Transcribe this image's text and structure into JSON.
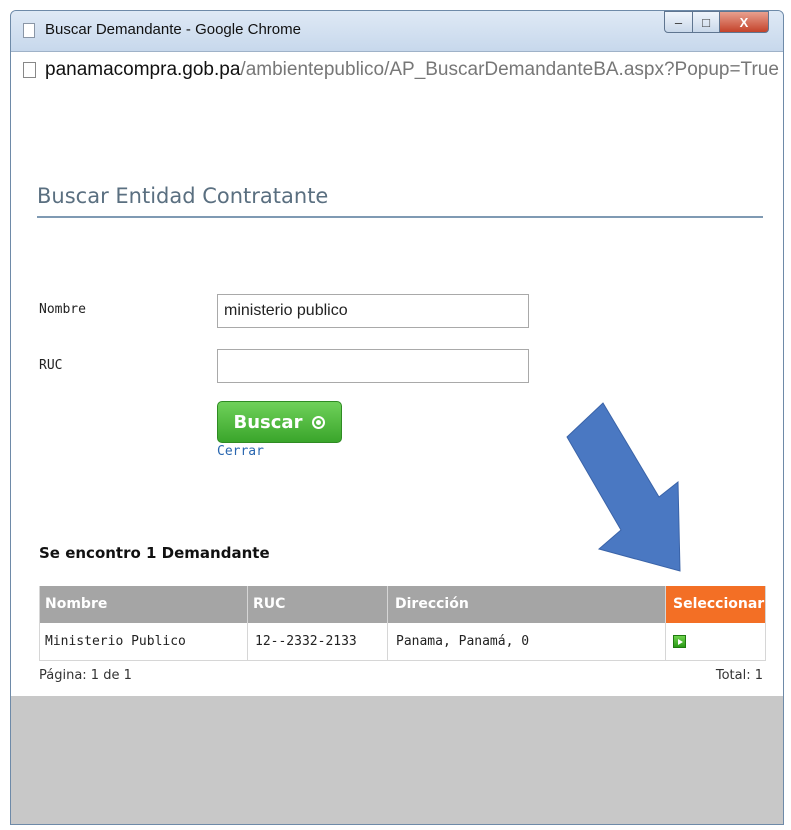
{
  "window": {
    "title": "Buscar Demandante - Google Chrome",
    "controls": {
      "minimize": "–",
      "maximize": "□",
      "close": "X"
    }
  },
  "address_bar": {
    "host": "panamacompra.gob.pa",
    "path": "/ambientepublico/AP_BuscarDemandanteBA.aspx?Popup=True"
  },
  "page": {
    "heading": "Buscar Entidad Contratante",
    "form": {
      "nombre_label": "Nombre",
      "nombre_value": "ministerio publico",
      "ruc_label": "RUC",
      "ruc_value": "",
      "search_button": "Buscar",
      "close_link": "Cerrar"
    },
    "results": {
      "title": "Se encontro 1 Demandante",
      "columns": [
        "Nombre",
        "RUC",
        "Dirección",
        "Seleccionar"
      ],
      "rows": [
        {
          "nombre": "Ministerio Publico",
          "ruc": "12--2332-2133",
          "direccion": "Panama, Panamá, 0"
        }
      ],
      "pagination": "Página: 1 de 1",
      "total": "Total: 1"
    }
  },
  "colors": {
    "header_gray": "#a5a5a5",
    "select_header_orange": "#f36f25",
    "button_green": "#3aa52b",
    "arrow_blue": "#4a78c2"
  },
  "icons": [
    "page-icon",
    "select-arrow-icon",
    "radio-dot-icon"
  ]
}
